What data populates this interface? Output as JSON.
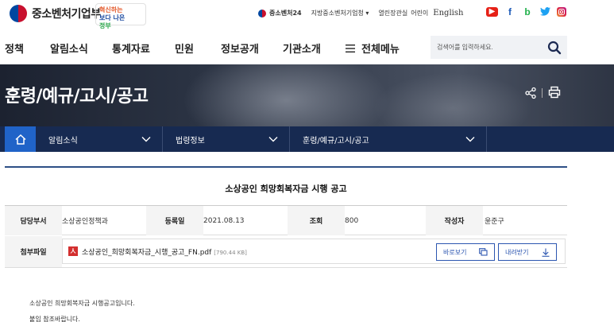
{
  "header": {
    "logo_text": "중소벤처기업부",
    "slogan_line1": "혁신하는",
    "slogan_line2": "보다 나은",
    "slogan_line3": "정부",
    "util": {
      "service24": "중소벤처24",
      "regional": "지방중소벤처기업청 ▾",
      "open_hall": "열린장관실",
      "kids": "어린이",
      "english": "English"
    },
    "sns": [
      "youtube-icon",
      "facebook-icon",
      "blog-icon",
      "twitter-icon",
      "instagram-icon"
    ]
  },
  "nav": {
    "items": [
      "정책",
      "알림소식",
      "통계자료",
      "민원",
      "정보공개",
      "기관소개"
    ],
    "all_menu": "전체메뉴",
    "search_placeholder": "검색어를 입력하세요."
  },
  "banner": {
    "title": "훈령/예규/고시/공고"
  },
  "breadcrumb": {
    "level1": "알림소식",
    "level2": "법령정보",
    "level3": "훈령/예규/고시/공고"
  },
  "article": {
    "title": "소상공인 희망회복자금 시행 공고",
    "meta": {
      "dept_label": "담당부서",
      "dept_value": "소상공인정책과",
      "date_label": "등록일",
      "date_value": "2021.08.13",
      "views_label": "조회",
      "views_value": "800",
      "author_label": "작성자",
      "author_value": "윤준구"
    },
    "attachment": {
      "label": "첨부파일",
      "filename": "소상공인_희망회복자금_시행_공고_FN.pdf",
      "filesize": "[790.44 KB]",
      "view_button": "바로보기",
      "download_button": "내려받기"
    },
    "body_line1": "소상공인 희망회복자금 시행공고입니다.",
    "body_line2": "붙임 참조바랍니다."
  },
  "colors": {
    "nav_dark": "#172a51",
    "home_blue": "#2063c8",
    "accent_blue": "#2c56b0",
    "pdf_red": "#d32f2f"
  }
}
